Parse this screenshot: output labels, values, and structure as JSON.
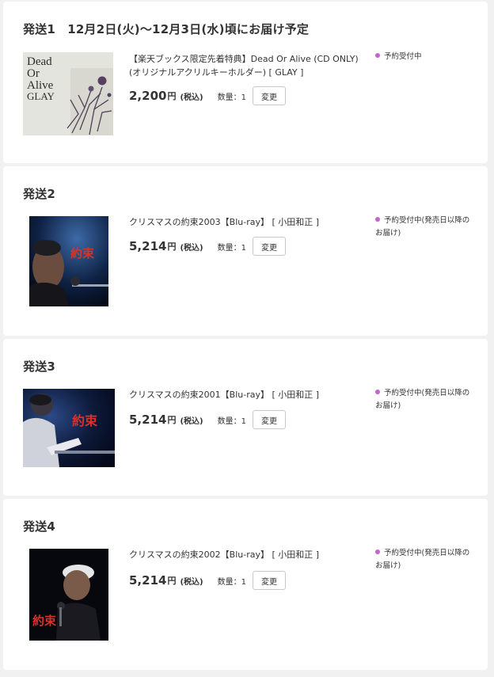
{
  "colors": {
    "status_dot": "#c465c9",
    "page_bg": "#f1f1f1",
    "card_bg": "#ffffff"
  },
  "shipments": [
    {
      "title": "発送1　12月2日(火)〜12月3日(水)頃にお届け予定",
      "item": {
        "title": "【楽天ブックス限定先着特典】Dead Or Alive (CD ONLY)(オリジナルアクリルキーホルダー) [ GLAY ]",
        "price": "2,200",
        "price_unit": "円",
        "tax_label": "(税込)",
        "quantity": "数量：1",
        "change_label": "変更",
        "status": "予約受付中",
        "cover_text": [
          "Dead",
          "Or",
          "Alive",
          "GLAY"
        ]
      }
    },
    {
      "title": "発送2",
      "item": {
        "title": "クリスマスの約束2003【Blu-ray】 [ 小田和正 ]",
        "price": "5,214",
        "price_unit": "円",
        "tax_label": "(税込)",
        "quantity": "数量：1",
        "change_label": "変更",
        "status": "予約受付中(発売日以降のお届け)",
        "cover_text": [
          "約束"
        ]
      }
    },
    {
      "title": "発送3",
      "item": {
        "title": "クリスマスの約束2001【Blu-ray】 [ 小田和正 ]",
        "price": "5,214",
        "price_unit": "円",
        "tax_label": "(税込)",
        "quantity": "数量：1",
        "change_label": "変更",
        "status": "予約受付中(発売日以降のお届け)",
        "cover_text": [
          "約束"
        ]
      }
    },
    {
      "title": "発送4",
      "item": {
        "title": "クリスマスの約束2002【Blu-ray】 [ 小田和正 ]",
        "price": "5,214",
        "price_unit": "円",
        "tax_label": "(税込)",
        "quantity": "数量：1",
        "change_label": "変更",
        "status": "予約受付中(発売日以降のお届け)",
        "cover_text": [
          "約束"
        ]
      }
    }
  ]
}
